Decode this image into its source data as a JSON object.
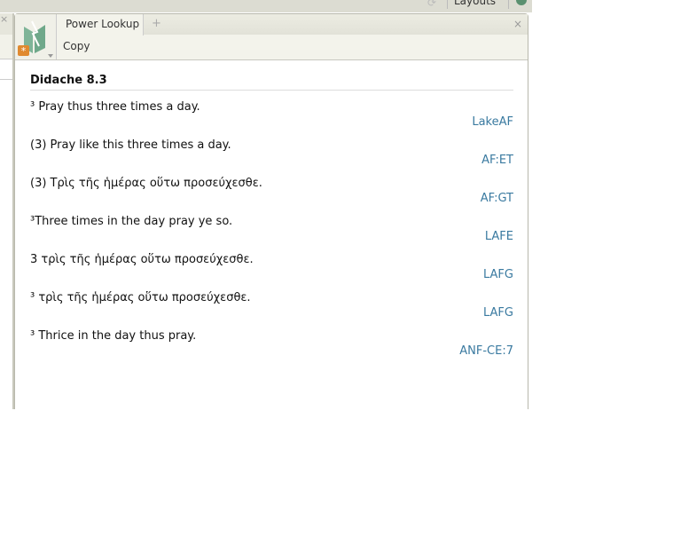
{
  "topbar": {
    "layouts_label": "Layouts"
  },
  "panel": {
    "tab_label": "Power Lookup",
    "add_tab": "+",
    "close": "×",
    "toolbar": {
      "copy_label": "Copy"
    }
  },
  "content": {
    "title": "Didache 8.3",
    "entries": [
      {
        "text": "³ Pray thus three times a day.",
        "source": "LakeAF"
      },
      {
        "text": "(3) Pray like this three times a day.",
        "source": "AF:ET"
      },
      {
        "text": "(3) Τρὶς τῆς ἡμέρας οὕτω προσεύχεσθε.",
        "source": "AF:GT"
      },
      {
        "text": "³Three times in the day pray ye so.",
        "source": "LAFE"
      },
      {
        "text": "3 τρὶς τῆς ἡμέρας οὕτω προσεύχεσθε.",
        "source": "LAFG"
      },
      {
        "text": "³ τρὶς τῆς ἡμέρας οὕτω προσεύχεσθε.",
        "source": "LAFG"
      },
      {
        "text": "³ Thrice in the day thus pray.",
        "source": "ANF-CE:7"
      }
    ]
  },
  "colors": {
    "link": "#3a7aa0",
    "logo": "#6fa88a",
    "badge": "#e08a30"
  }
}
